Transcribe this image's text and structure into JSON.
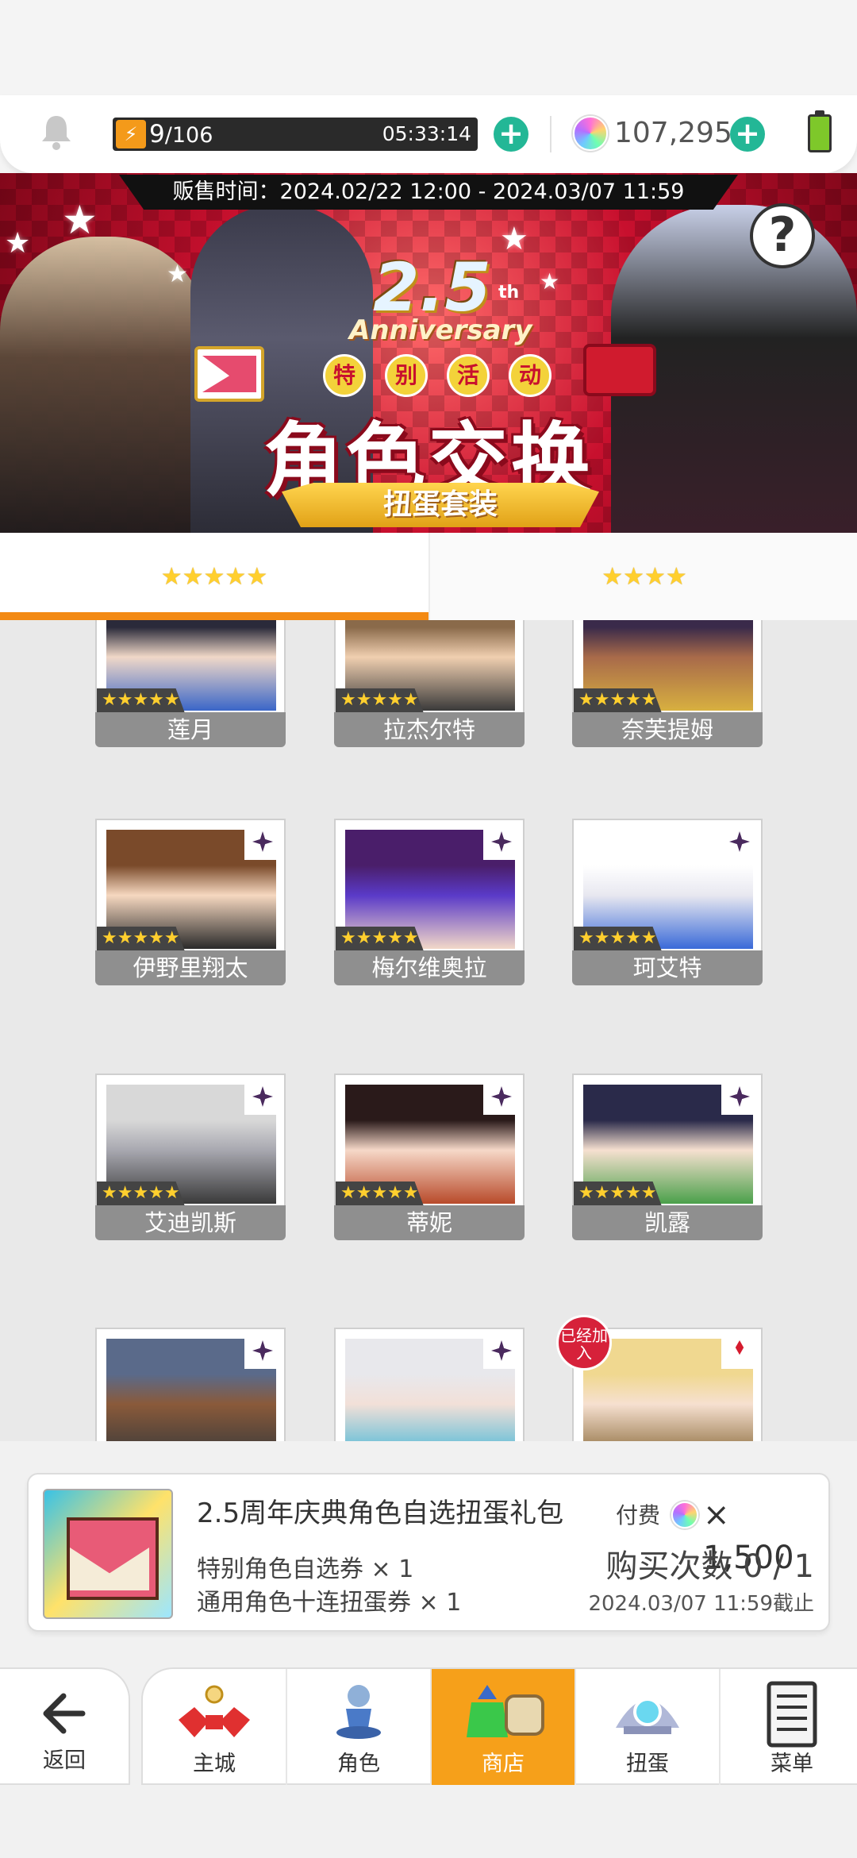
{
  "header": {
    "stamina_current": "9",
    "stamina_max": "/106",
    "stamina_timer": "05:33:14",
    "gems": "107,295",
    "stamina_icon": "lightning-icon",
    "gem_icon": "rainbow-gem-icon"
  },
  "banner": {
    "sale_time": "贩售时间：2024.02/22 12:00 - 2024.03/07 11:59",
    "anniversary_number": "2.5",
    "anniversary_suffix": "th",
    "anniversary_text": "Anniversary",
    "special_event_chars": [
      "特",
      "别",
      "活",
      "动"
    ],
    "title": "角色交换",
    "subtitle": "扭蛋套装"
  },
  "tabs": [
    {
      "label": "★★★★★",
      "active": true
    },
    {
      "label": "★★★★",
      "active": false
    }
  ],
  "characters": [
    {
      "name": "莲月",
      "stars": "★★★★★",
      "badge": "none",
      "colors": [
        "#2a2a3a",
        "#f0d8c8",
        "#3a66c8"
      ]
    },
    {
      "name": "拉杰尔特",
      "stars": "★★★★★",
      "badge": "none",
      "colors": [
        "#8a6a4a",
        "#f0cfb0",
        "#3a3a3a"
      ]
    },
    {
      "name": "奈芙提姆",
      "stars": "★★★★★",
      "badge": "none",
      "colors": [
        "#3a2a4a",
        "#a86a4a",
        "#d8b040"
      ]
    },
    {
      "name": "伊野里翔太",
      "stars": "★★★★★",
      "badge": "diamond",
      "colors": [
        "#7a4a2a",
        "#f6d8c0",
        "#2a2a2a"
      ]
    },
    {
      "name": "梅尔维奥拉",
      "stars": "★★★★★",
      "badge": "diamond",
      "colors": [
        "#4a1e6a",
        "#5a3ac8",
        "#f2d8c8"
      ]
    },
    {
      "name": "珂艾特",
      "stars": "★★★★★",
      "badge": "diamond",
      "colors": [
        "#ffffff",
        "#e8e8f0",
        "#3a6ad8"
      ]
    },
    {
      "name": "艾迪凯斯",
      "stars": "★★★★★",
      "badge": "diamond",
      "colors": [
        "#d8d8d8",
        "#a8a8b0",
        "#3a3a3a"
      ]
    },
    {
      "name": "蒂妮",
      "stars": "★★★★★",
      "badge": "diamond",
      "colors": [
        "#2a1a1a",
        "#f6d8c8",
        "#b84a2a"
      ]
    },
    {
      "name": "凯露",
      "stars": "★★★★★",
      "badge": "diamond",
      "colors": [
        "#2a2a4a",
        "#f6e0d0",
        "#4aa04a"
      ]
    },
    {
      "name": "",
      "stars": "",
      "badge": "diamond",
      "colors": [
        "#5a6a8a",
        "#8a5a3a",
        "#3a3a3a"
      ]
    },
    {
      "name": "",
      "stars": "",
      "badge": "diamond",
      "colors": [
        "#e8e8ec",
        "#f2e0d8",
        "#4ab8d8"
      ]
    },
    {
      "name": "",
      "stars": "",
      "badge": "red-diamond",
      "joined": "已经加入",
      "colors": [
        "#f0d890",
        "#f6e0d0",
        "#8a6a3a"
      ]
    }
  ],
  "purchase": {
    "title": "2.5周年庆典角色自选扭蛋礼包",
    "pay_label": "付费",
    "price": "× 1,500",
    "line1": "特别角色自选券 × 1",
    "line2": "通用角色十连扭蛋券 × 1",
    "buy_count": "购买次数 0 / 1",
    "deadline": "2024.03/07 11:59截止"
  },
  "nav": {
    "back": "返回",
    "items": [
      {
        "label": "主城",
        "icon": "castle-icon",
        "active": false
      },
      {
        "label": "角色",
        "icon": "character-icon",
        "active": false
      },
      {
        "label": "商店",
        "icon": "shop-icon",
        "active": true
      },
      {
        "label": "扭蛋",
        "icon": "gacha-icon",
        "active": false
      },
      {
        "label": "菜单",
        "icon": "menu-list-icon",
        "active": false
      }
    ]
  },
  "colors": {
    "accent_orange": "#f38a14",
    "nav_active": "#f6a01a",
    "plus_green": "#23b796",
    "banner_red": "#c8102e"
  }
}
